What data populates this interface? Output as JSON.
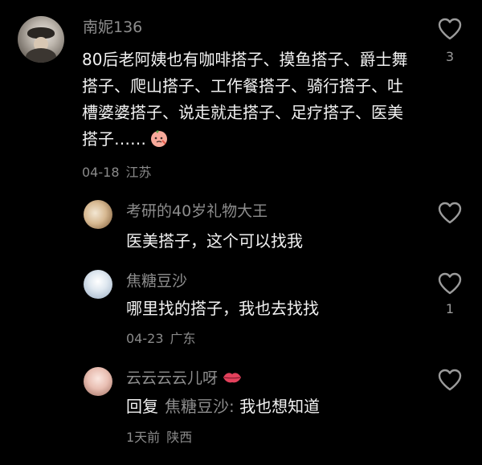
{
  "comment": {
    "username": "南妮136",
    "text": "80后老阿姨也有咖啡搭子、摸鱼搭子、爵士舞搭子、爬山搭子、工作餐搭子、骑行搭子、吐槽婆婆搭子、说走就走搭子、足疗搭子、医美搭子……",
    "date": "04-18",
    "location": "江苏",
    "like_count": "3",
    "emoji": "peach-face-emoji"
  },
  "replies": [
    {
      "username": "考研的40岁礼物大王",
      "text": "医美搭子，这个可以找我"
    },
    {
      "username": "焦糖豆沙",
      "text": "哪里找的搭子，我也去找找",
      "date": "04-23",
      "location": "广东",
      "like_count": "1"
    },
    {
      "username": "云云云云儿呀",
      "username_emoji": "lips-icon",
      "reply_prefix": "回复",
      "reply_to": "焦糖豆沙:",
      "text": "我也想知道",
      "date": "1天前",
      "location": "陕西"
    }
  ],
  "colors": {
    "background": "#000000",
    "username": "#8d8d8d",
    "text": "#f2f2f2",
    "meta": "#8a8a8a"
  }
}
